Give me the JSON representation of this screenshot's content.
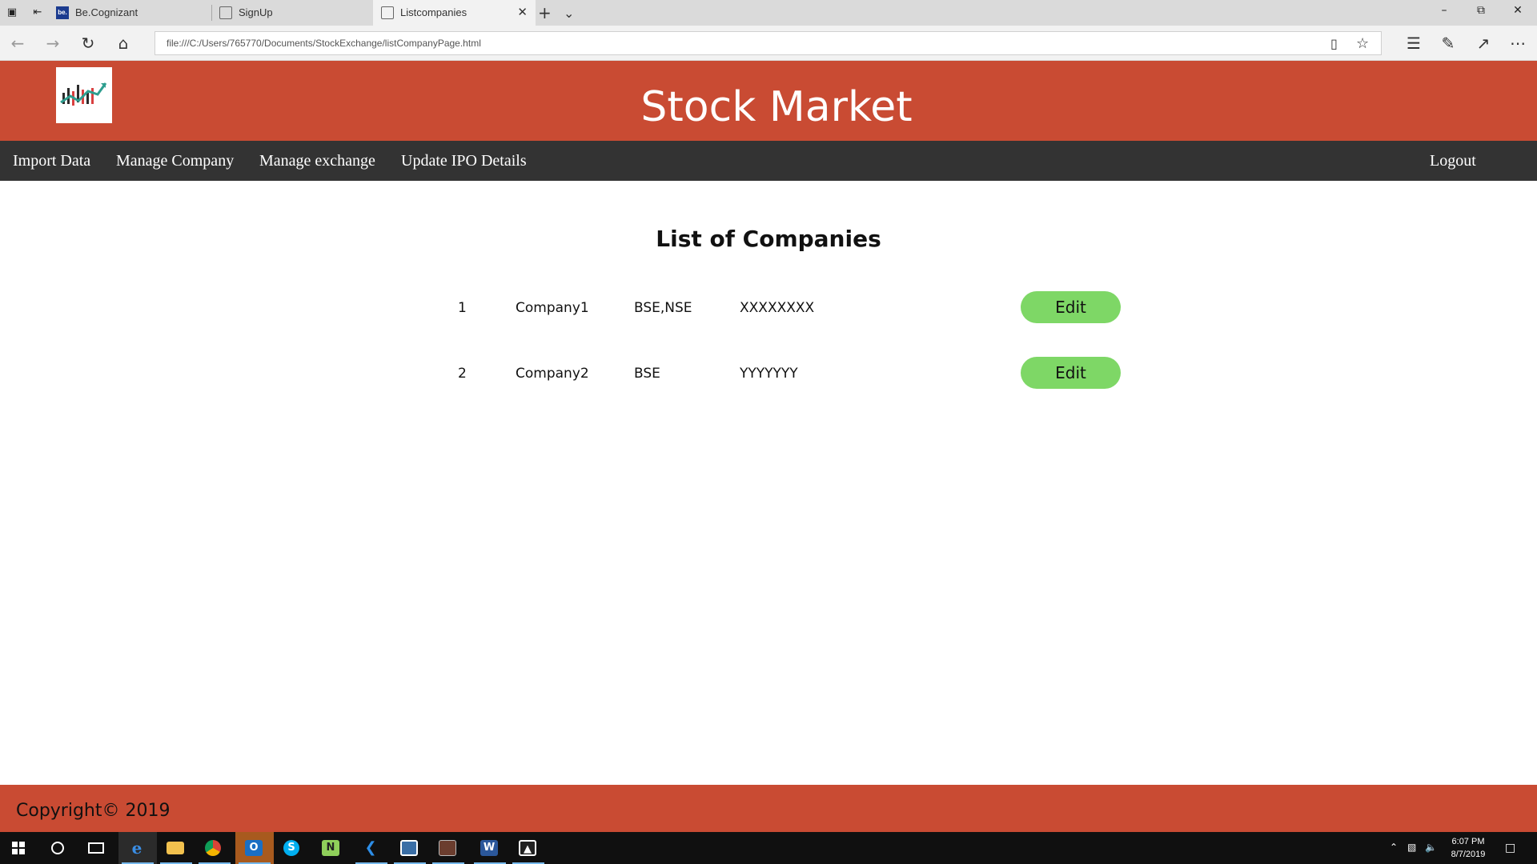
{
  "browser": {
    "tabs": [
      {
        "label": "Be.Cognizant",
        "favicon": "be"
      },
      {
        "label": "SignUp",
        "favicon": "page-icon"
      },
      {
        "label": "Listcompanies",
        "favicon": "page-icon",
        "active": true
      }
    ],
    "url": "file:///C:/Users/765770/Documents/StockExchange/listCompanyPage.html"
  },
  "header": {
    "title": "Stock Market",
    "color": "#c94b33"
  },
  "nav": {
    "items": [
      "Import Data",
      "Manage Company",
      "Manage exchange",
      "Update IPO Details"
    ],
    "logout": "Logout"
  },
  "main": {
    "heading": "List of Companies",
    "companies": [
      {
        "index": "1",
        "name": "Company1",
        "exchanges": "BSE,NSE",
        "code": "XXXXXXXX",
        "action": "Edit"
      },
      {
        "index": "2",
        "name": "Company2",
        "exchanges": "BSE",
        "code": "YYYYYYY",
        "action": "Edit"
      }
    ],
    "button_color": "#7ed766"
  },
  "footer": {
    "text": "Copyright© 2019"
  },
  "taskbar": {
    "time": "6:07 PM",
    "date": "8/7/2019"
  }
}
